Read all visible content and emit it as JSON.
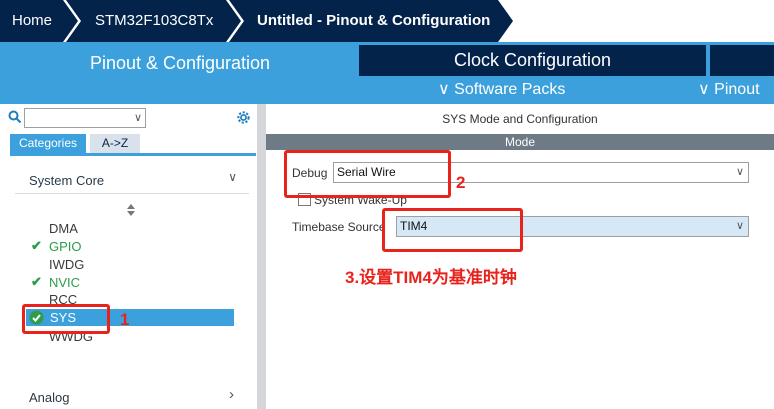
{
  "breadcrumb": [
    "Home",
    "STM32F103C8Tx",
    "Untitled - Pinout & Configuration"
  ],
  "tabs": {
    "active": "Pinout & Configuration",
    "clock": "Clock Configuration",
    "software_packs": "Software Packs",
    "pinout": "Pinout"
  },
  "left": {
    "search_placeholder": "",
    "cat_tabs": [
      "Categories",
      "A->Z"
    ],
    "sections": [
      "System Core",
      "Analog"
    ],
    "items": [
      "DMA",
      "GPIO",
      "IWDG",
      "NVIC",
      "RCC",
      "SYS",
      "WWDG"
    ]
  },
  "right": {
    "title": "SYS Mode and Configuration",
    "mode_header": "Mode",
    "debug_label": "Debug",
    "debug_value": "Serial Wire",
    "wakeup_label": "System Wake-Up",
    "timebase_label": "Timebase Source",
    "timebase_value": "TIM4"
  },
  "annotations": {
    "one": "1",
    "two": "2",
    "three": "3.设置TIM4为基准时钟"
  },
  "colors": {
    "navy": "#03234b",
    "accent_blue": "#3ca0dc",
    "annotation_red": "#e8231c",
    "check_green": "#2e9c4a"
  }
}
